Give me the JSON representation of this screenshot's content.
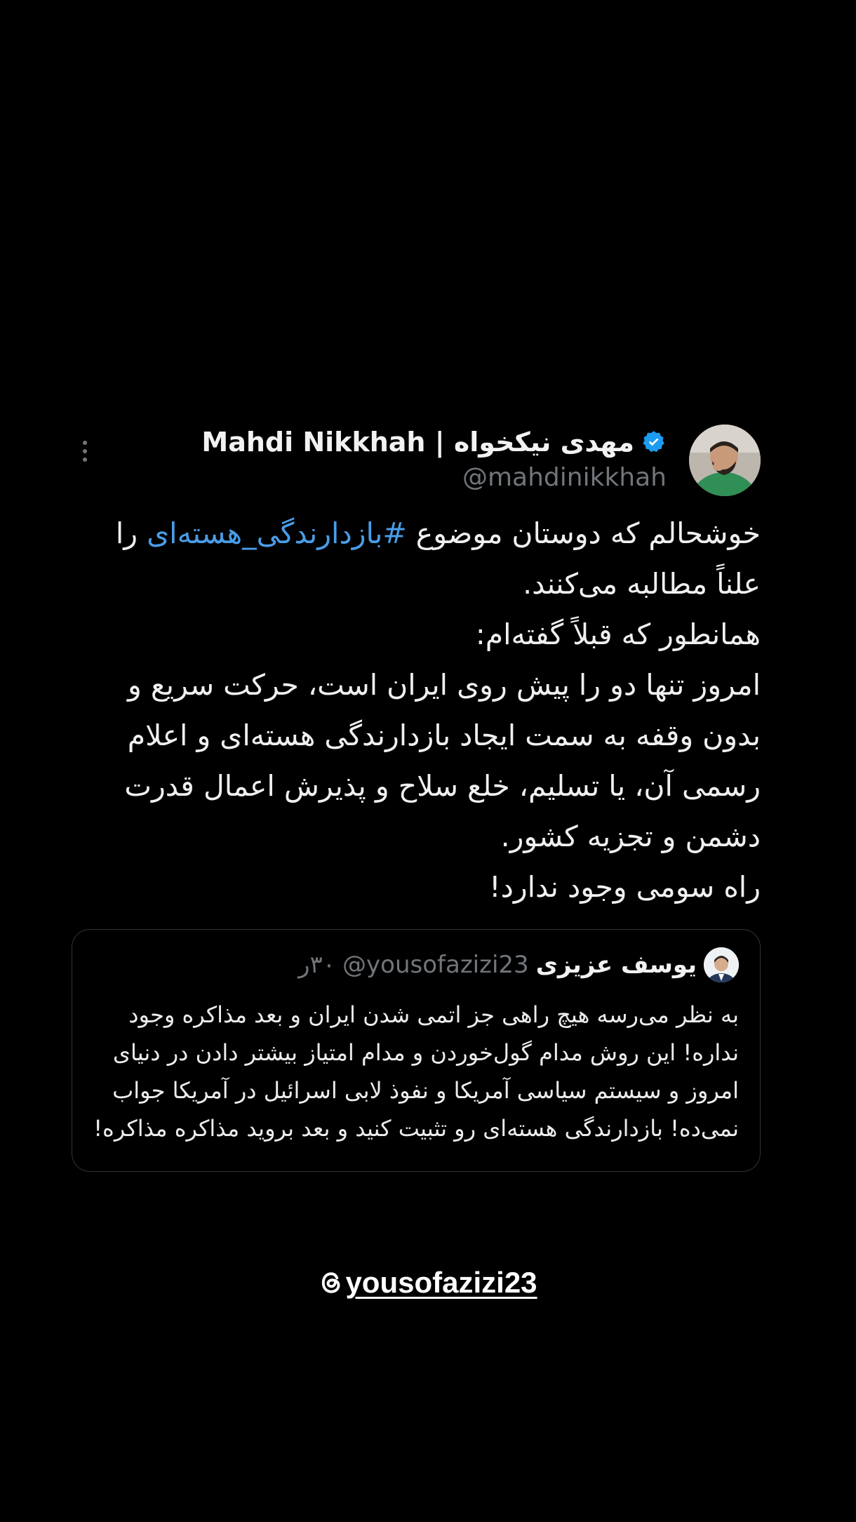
{
  "tweet": {
    "display_name": "مهدی نیکخواه | Mahdi Nikkhah",
    "handle": "@mahdinikkhah",
    "verified_icon": "verified-badge-icon",
    "more_icon": "more-vertical-icon",
    "accent_color": "#1d9bf0",
    "text_prefix": "خوشحالم که دوستان موضوع ",
    "hashtag": "#بازدارندگی_هسته‌ای",
    "text_suffix": " را علناً مطالبه می‌کنند.",
    "line2": "همانطور که قبلاً گفته‌ام:",
    "line3": "امروز تنها دو را پیش روی ایران است، حرکت سریع و بدون وقفه به سمت ایجاد بازدارندگی هسته‌ای و اعلام رسمی آن، یا تسلیم، خلع سلاح و پذیرش اعمال قدرت دشمن و تجزیه کشور.",
    "line4": "راه سومی وجود ندارد!"
  },
  "quote": {
    "display_name": "یوسف عزیزی",
    "handle": "@yousofazizi23",
    "time": "۳۰ر",
    "text": "به نظر می‌رسه هیچ راهی جز اتمی شدن ایران و بعد مذاکره وجود نداره! این روش مدام گول‌خوردن و مدام امتیاز بیشتر دادن در دنیای امروز و سیستم سیاسی آمریکا و نفوذ لابی اسرائیل در آمریکا جواب نمی‌ده! بازدارندگی هسته‌ای رو تثبیت کنید و بعد بروید مذاکره مذاکره!"
  },
  "watermark": {
    "icon": "threads-icon",
    "handle": "yousofazizi23"
  }
}
